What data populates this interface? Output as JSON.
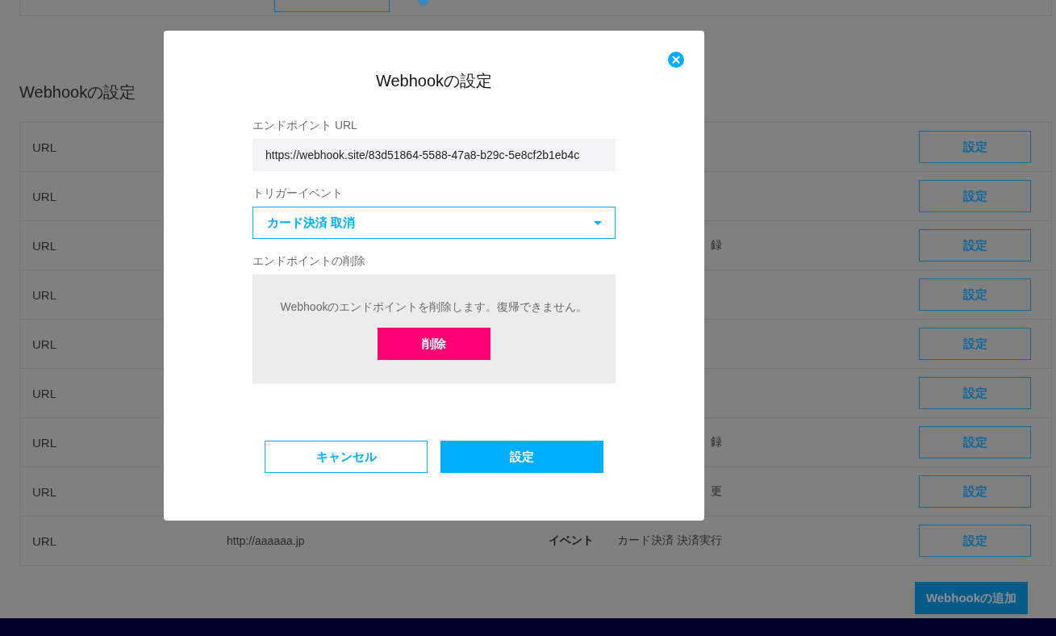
{
  "page": {
    "heading": "Webhookの設定",
    "webhooks": [
      {
        "label": "URL",
        "button": "設定"
      },
      {
        "label": "URL",
        "button": "設定"
      },
      {
        "label": "URL",
        "event": "録",
        "button": "設定"
      },
      {
        "label": "URL",
        "button": "設定"
      },
      {
        "label": "URL",
        "button": "設定"
      },
      {
        "label": "URL",
        "button": "設定"
      },
      {
        "label": "URL",
        "event": "録",
        "button": "設定"
      },
      {
        "label": "URL",
        "event": "更",
        "button": "設定"
      },
      {
        "label": "URL",
        "url": "http://aaaaaa.jp",
        "event_label": "イベント",
        "event": "カード決済 決済実行",
        "button": "設定"
      }
    ],
    "add_button": "Webhookの追加"
  },
  "modal": {
    "title": "Webhookの設定",
    "endpoint_url": {
      "label": "エンドポイント URL",
      "value": "https://webhook.site/83d51864-5588-47a8-b29c-5e8cf2b1eb4c"
    },
    "trigger_event": {
      "label": "トリガーイベント",
      "value": "カード決済 取消"
    },
    "delete_endpoint": {
      "label": "エンドポイントの削除",
      "message": "Webhookのエンドポイントを削除します。復帰できません。",
      "button": "削除"
    },
    "buttons": [
      {
        "label": "キャンセル",
        "kind": "secondary"
      },
      {
        "label": "設定",
        "kind": "primary"
      }
    ]
  }
}
